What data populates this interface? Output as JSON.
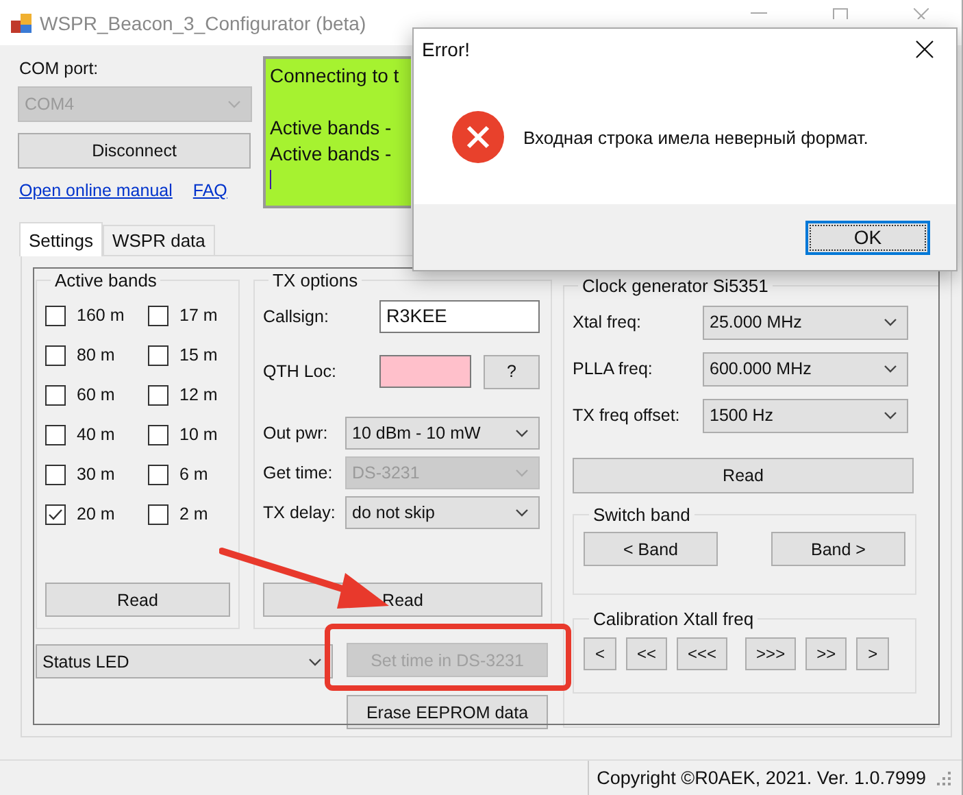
{
  "window": {
    "title": "WSPR_Beacon_3_Configurator (beta)"
  },
  "com_port": {
    "label": "COM port:",
    "value": "COM4",
    "disabled": true
  },
  "connect_button": "Disconnect",
  "links": [
    "Open online manual",
    "FAQ"
  ],
  "log": {
    "paragraphs": [
      [
        "Connecting to t"
      ],
      [
        "Active bands -",
        "Active bands -"
      ]
    ]
  },
  "tabs": [
    {
      "label": "Settings",
      "selected": true
    },
    {
      "label": "WSPR data",
      "selected": false
    }
  ],
  "active_bands": {
    "title": "Active bands",
    "bands": [
      {
        "label": "160 m",
        "checked": false
      },
      {
        "label": "17 m",
        "checked": false
      },
      {
        "label": "80 m",
        "checked": false
      },
      {
        "label": "15 m",
        "checked": false
      },
      {
        "label": "60 m",
        "checked": false
      },
      {
        "label": "12 m",
        "checked": false
      },
      {
        "label": "40 m",
        "checked": false
      },
      {
        "label": "10 m",
        "checked": false
      },
      {
        "label": "30 m",
        "checked": false
      },
      {
        "label": "6 m",
        "checked": false
      },
      {
        "label": "20 m",
        "checked": true
      },
      {
        "label": "2 m",
        "checked": false
      }
    ],
    "button": "Read"
  },
  "tx_options": {
    "title": "TX options",
    "fields": [
      {
        "kind": "text",
        "label": "Callsign:",
        "value": "R3KEE"
      },
      {
        "kind": "locator",
        "label": "QTH Loc:",
        "invalid": true,
        "button": "?"
      },
      {
        "kind": "combo",
        "label": "Out pwr:",
        "value": "10 dBm - 10 mW",
        "disabled": false
      },
      {
        "kind": "combo",
        "label": "Get time:",
        "value": "DS-3231",
        "disabled": true
      },
      {
        "kind": "combo",
        "label": "TX delay:",
        "value": "do not skip",
        "disabled": false
      }
    ],
    "button": "Read"
  },
  "led_mode": {
    "value": "Status LED"
  },
  "set_time_button": {
    "label": "Set time in DS-3231",
    "disabled": true
  },
  "erase_button": "Erase EEPROM data",
  "clock": {
    "title": "Clock generator Si5351",
    "fields": [
      {
        "label": "Xtal freq:",
        "value": "25.000 MHz"
      },
      {
        "label": "PLLA freq:",
        "value": "600.000 MHz"
      },
      {
        "label": "TX freq offset:",
        "value": "1500 Hz"
      }
    ],
    "button": "Read"
  },
  "switch_band": {
    "title": "Switch band",
    "buttons": [
      "< Band",
      "Band >"
    ]
  },
  "calibration": {
    "title": "Calibration Xtall freq",
    "buttons": [
      "<",
      "<<",
      "<<<",
      ">>>",
      ">>",
      ">"
    ]
  },
  "status_bar": {
    "text": "Copyright ©R0AEK, 2021. Ver. 1.0.7999"
  },
  "dialog": {
    "title": "Error!",
    "message": "Входная строка имела неверный формат.",
    "button": "OK"
  }
}
